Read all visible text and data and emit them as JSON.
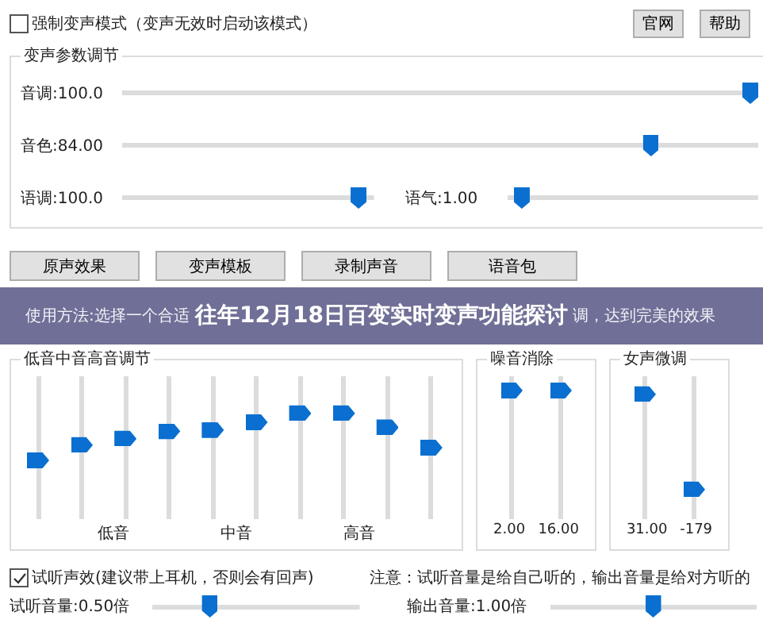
{
  "force_mode": {
    "label": "强制变声模式（变声无效时启动该模式）",
    "checked": false
  },
  "header_buttons": [
    "官网",
    "帮助"
  ],
  "voice_params": {
    "title": "变声参数调节",
    "rows": [
      [
        {
          "label": "音调:100.0",
          "level": 1
        }
      ],
      [
        {
          "label": "音色:84.00",
          "level": 0.84
        }
      ],
      [
        {
          "label": "语调:100.0",
          "level": 0.97
        },
        {
          "label": "语气:1.00",
          "level": 0.03
        }
      ]
    ]
  },
  "actions": [
    "原声效果",
    "变声模板",
    "录制声音",
    "语音包"
  ],
  "usage": {
    "visible_start": "使用方法:选择一个合适",
    "visible_end": "调，达到完美的效果"
  },
  "banner": {
    "title": "往年12月18日百变实时变声功能探讨"
  },
  "eq": {
    "title": "低音中音高音调节",
    "bands": [
      {
        "level": 0.4
      },
      {
        "level": 0.52
      },
      {
        "level": 0.57
      },
      {
        "level": 0.63
      },
      {
        "level": 0.64
      },
      {
        "level": 0.7
      },
      {
        "level": 0.77
      },
      {
        "level": 0.77
      },
      {
        "level": 0.66
      },
      {
        "level": 0.5
      }
    ],
    "labels": [
      "低音",
      "中音",
      "高音"
    ]
  },
  "noise": {
    "title": "噪音消除",
    "sliders": [
      {
        "level": 0.95,
        "reading": "2.00"
      },
      {
        "level": 0.95,
        "reading": "16.00"
      }
    ]
  },
  "female": {
    "title": "女声微调",
    "sliders": [
      {
        "level": 0.92,
        "reading": "31.00"
      },
      {
        "level": 0.17,
        "reading": "-179"
      }
    ]
  },
  "monitor": {
    "label": "试听声效(建议带上耳机，否则会有回声)",
    "checked": true
  },
  "note": "注意：试听音量是给自己听的，输出音量是给对方听的",
  "volumes": [
    {
      "label": "试听音量:0.50倍",
      "level": 0.26
    },
    {
      "label": "输出音量:1.00倍",
      "level": 0.5
    }
  ]
}
